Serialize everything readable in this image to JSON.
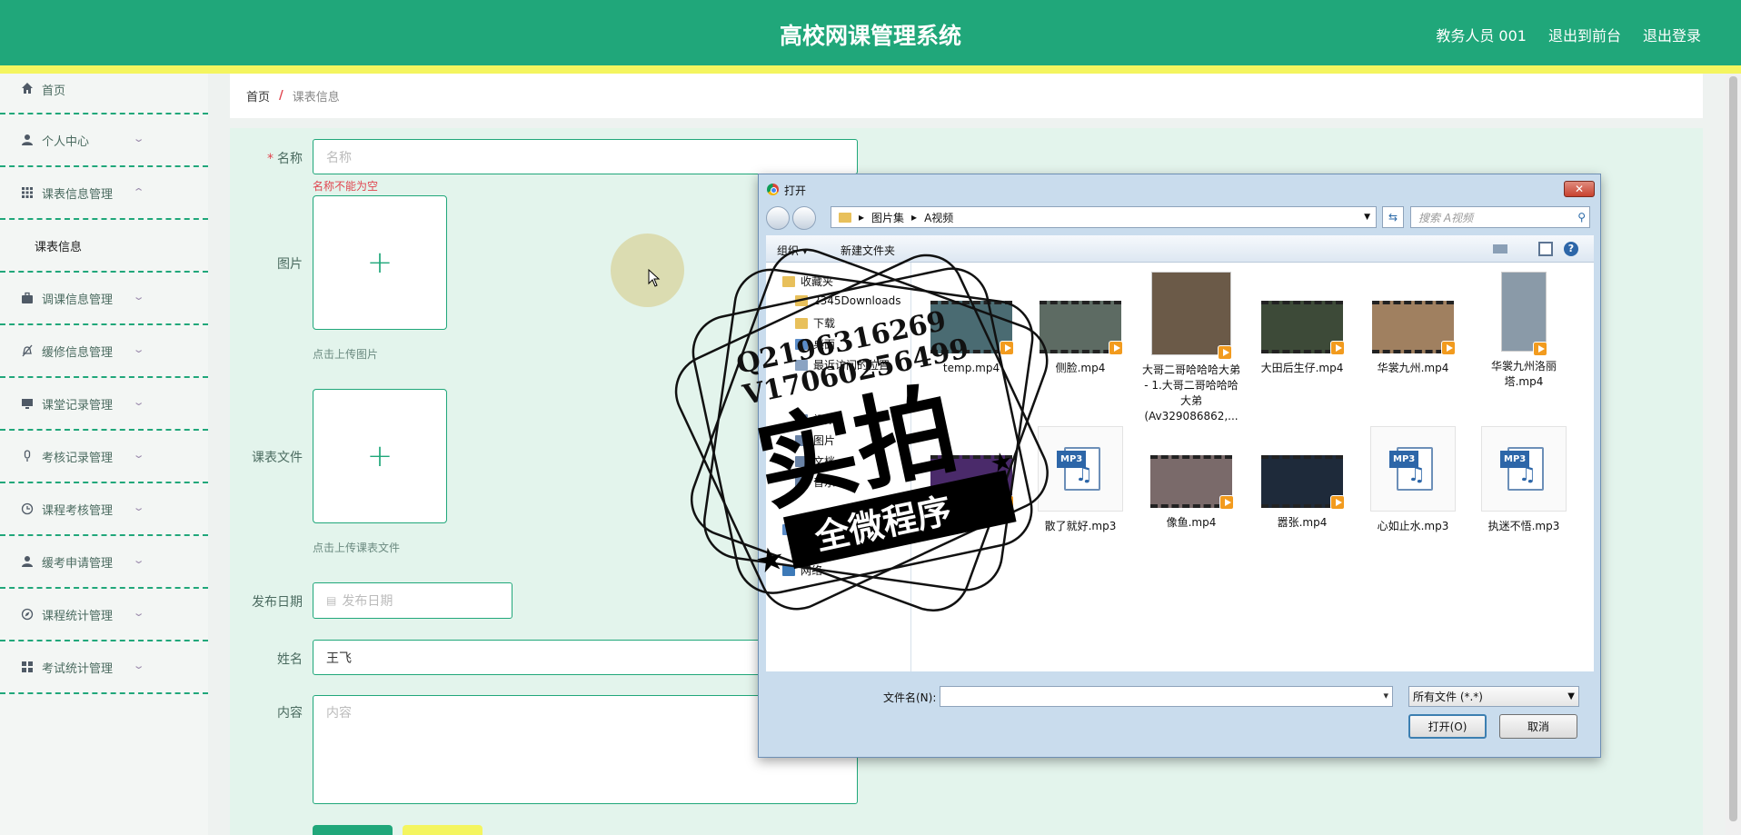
{
  "header": {
    "title": "高校网课管理系统",
    "links": [
      "教务人员 001",
      "退出到前台",
      "退出登录"
    ]
  },
  "sidebar": {
    "items": [
      {
        "label": "首页",
        "icon": "home-icon"
      },
      {
        "label": "个人中心",
        "icon": "user-icon"
      },
      {
        "label": "课表信息管理",
        "icon": "grid-icon"
      },
      {
        "label": "调课信息管理",
        "icon": "briefcase-icon"
      },
      {
        "label": "缓修信息管理",
        "icon": "bell-off-icon"
      },
      {
        "label": "课堂记录管理",
        "icon": "monitor-icon"
      },
      {
        "label": "考核记录管理",
        "icon": "microphone-icon"
      },
      {
        "label": "课程考核管理",
        "icon": "clock-icon"
      },
      {
        "label": "缓考申请管理",
        "icon": "user-icon"
      },
      {
        "label": "课程统计管理",
        "icon": "compass-icon"
      },
      {
        "label": "考试统计管理",
        "icon": "apps-icon"
      }
    ],
    "sub_item": "课表信息"
  },
  "breadcrumb": {
    "home": "首页",
    "separator": "/",
    "current": "课表信息"
  },
  "form": {
    "name_label": "名称",
    "name_placeholder": "名称",
    "name_error": "名称不能为空",
    "image_label": "图片",
    "image_hint": "点击上传图片",
    "file_label": "课表文件",
    "file_hint": "点击上传课表文件",
    "date_label": "发布日期",
    "date_placeholder": "发布日期",
    "person_label": "姓名",
    "person_value": "王飞",
    "content_label": "内容",
    "content_placeholder": "内容",
    "plus": "+"
  },
  "dialog": {
    "title": "打开",
    "close": "✕",
    "path": [
      "图片集",
      "A视频"
    ],
    "search_placeholder": "搜索 A视频",
    "toolbar": {
      "organize": "组织 ▾",
      "new_folder": "新建文件夹"
    },
    "tree": [
      "收藏夹",
      "2345Downloads",
      "下载",
      "桌面",
      "最近访问的位置",
      "视频",
      "图片",
      "文档",
      "音乐",
      "计算机",
      "网络"
    ],
    "files": [
      {
        "name": "temp.mp4",
        "kind": "video"
      },
      {
        "name": "侧脸.mp4",
        "kind": "video"
      },
      {
        "name": "大哥二哥哈哈哈大弟 - 1.大哥二哥哈哈哈大弟(Av329086862,...",
        "kind": "video"
      },
      {
        "name": "大田后生仔.mp4",
        "kind": "video"
      },
      {
        "name": "华裳九州.mp4",
        "kind": "video"
      },
      {
        "name": "华裳九州洛丽塔.mp4",
        "kind": "video"
      },
      {
        "name": "...mp4",
        "kind": "video"
      },
      {
        "name": "散了就好.mp3",
        "kind": "audio"
      },
      {
        "name": "像鱼.mp4",
        "kind": "video"
      },
      {
        "name": "嚣张.mp4",
        "kind": "video"
      },
      {
        "name": "心如止水.mp3",
        "kind": "audio"
      },
      {
        "name": "执迷不悟.mp3",
        "kind": "audio"
      }
    ],
    "filename_label": "文件名(N):",
    "filetype": "所有文件 (*.*)",
    "open_button": "打开(O)",
    "cancel_button": "取消",
    "mp3_tag": "MP3",
    "note": "♫"
  },
  "watermark": {
    "line1": "Q2196316269",
    "line2": "V17060256499",
    "main": "实拍",
    "sub": "全微程序"
  },
  "colors": {
    "primary": "#20a77a",
    "accent": "#f4f55f",
    "error": "#e0454f"
  }
}
